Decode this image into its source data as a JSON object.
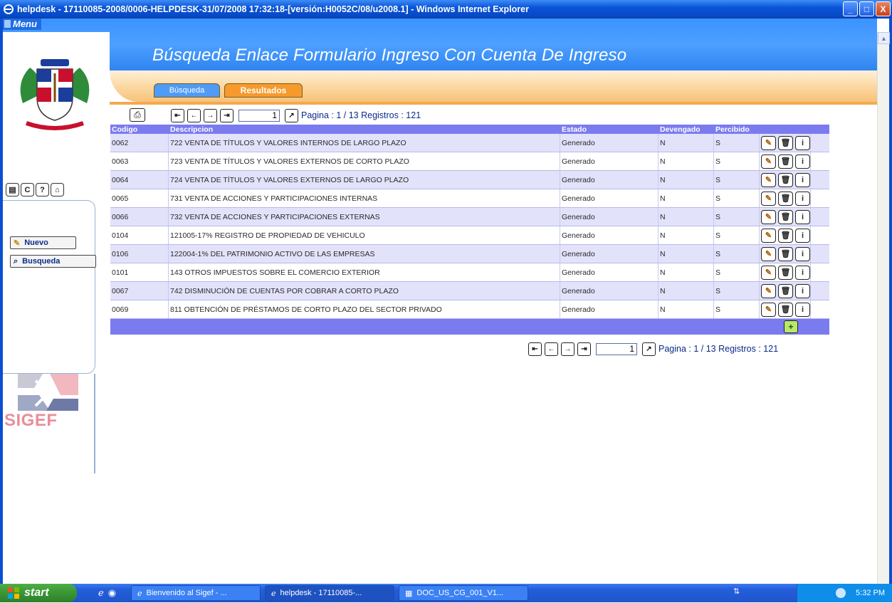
{
  "window": {
    "title": "helpdesk - 17110085-2008/0006-HELPDESK-31/07/2008 17:32:18-[versión:H0052C/08/u2008.1] - Windows Internet Explorer",
    "minimize": "_",
    "maximize": "□",
    "close": "X"
  },
  "header": {
    "menu_label": "Menu",
    "page_title": "Búsqueda Enlace Formulario Ingreso Con Cuenta De Ingreso"
  },
  "tabs": [
    {
      "label": "Búsqueda"
    },
    {
      "label": "Resultados"
    }
  ],
  "sidebar": {
    "nuevo_label": "Nuevo",
    "busqueda_label": "Busqueda",
    "logo_text": "SIGEF"
  },
  "pager": {
    "page_value": "1",
    "status": "Pagina : 1 / 13 Registros : 121"
  },
  "table": {
    "headers": [
      "Codigo",
      "Descripcion",
      "Estado",
      "Devengado",
      "Percibido"
    ],
    "rows": [
      {
        "codigo": "0062",
        "descripcion": "722 VENTA DE TÍTULOS Y VALORES INTERNOS DE LARGO PLAZO",
        "estado": "Generado",
        "devengado": "N",
        "percibido": "S"
      },
      {
        "codigo": "0063",
        "descripcion": "723 VENTA DE TÍTULOS Y VALORES EXTERNOS DE CORTO PLAZO",
        "estado": "Generado",
        "devengado": "N",
        "percibido": "S"
      },
      {
        "codigo": "0064",
        "descripcion": "724 VENTA DE TÍTULOS Y VALORES EXTERNOS DE LARGO PLAZO",
        "estado": "Generado",
        "devengado": "N",
        "percibido": "S"
      },
      {
        "codigo": "0065",
        "descripcion": "731 VENTA DE ACCIONES Y PARTICIPACIONES INTERNAS",
        "estado": "Generado",
        "devengado": "N",
        "percibido": "S"
      },
      {
        "codigo": "0066",
        "descripcion": "732 VENTA DE ACCIONES Y PARTICIPACIONES EXTERNAS",
        "estado": "Generado",
        "devengado": "N",
        "percibido": "S"
      },
      {
        "codigo": "0104",
        "descripcion": "121005-17% REGISTRO DE PROPIEDAD DE VEHICULO",
        "estado": "Generado",
        "devengado": "N",
        "percibido": "S"
      },
      {
        "codigo": "0106",
        "descripcion": "122004-1% DEL PATRIMONIO ACTIVO DE LAS EMPRESAS",
        "estado": "Generado",
        "devengado": "N",
        "percibido": "S"
      },
      {
        "codigo": "0101",
        "descripcion": "143 OTROS IMPUESTOS SOBRE EL COMERCIO EXTERIOR",
        "estado": "Generado",
        "devengado": "N",
        "percibido": "S"
      },
      {
        "codigo": "0067",
        "descripcion": "742 DISMINUCIÓN DE CUENTAS POR COBRAR A CORTO PLAZO",
        "estado": "Generado",
        "devengado": "N",
        "percibido": "S"
      },
      {
        "codigo": "0069",
        "descripcion": "811 OBTENCIÓN DE PRÉSTAMOS DE CORTO PLAZO DEL SECTOR PRIVADO",
        "estado": "Generado",
        "devengado": "N",
        "percibido": "S"
      }
    ]
  },
  "taskbar": {
    "start_label": "start",
    "tasks": [
      {
        "label": "Bienvenido al Sigef - ..."
      },
      {
        "label": "helpdesk - 17110085-..."
      },
      {
        "label": "DOC_US_CG_001_V1..."
      }
    ],
    "clock": "5:32 PM"
  }
}
